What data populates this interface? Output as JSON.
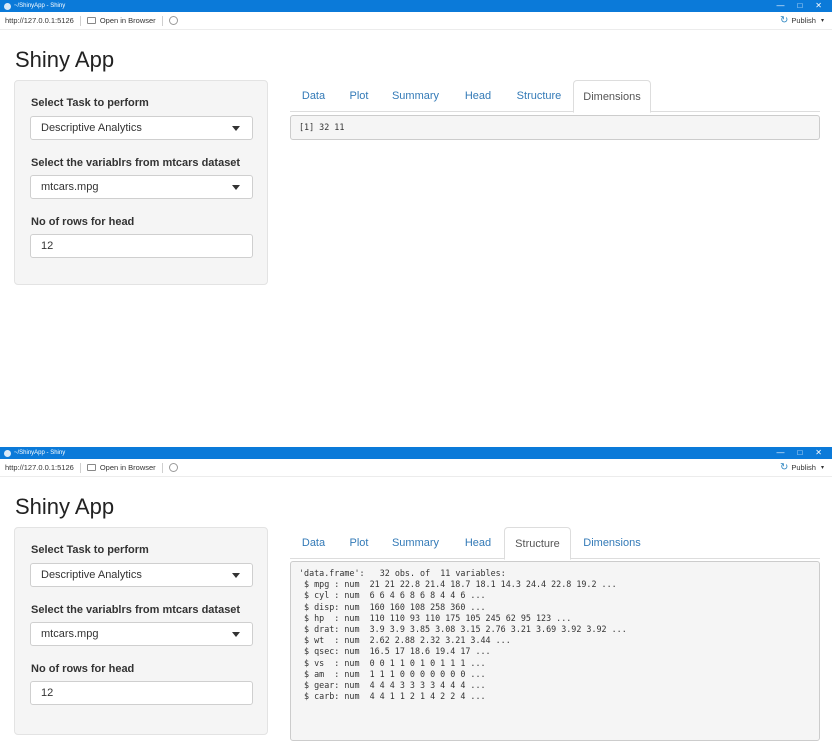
{
  "window": {
    "title": "~/ShinyApp - Shiny",
    "minimize": "—",
    "restore": "□",
    "close": "✕"
  },
  "toolbar": {
    "url": "http://127.0.0.1:5126",
    "open_in_browser": "Open in Browser",
    "publish": "Publish",
    "publish_caret": "▾"
  },
  "app": {
    "title": "Shiny App"
  },
  "sidebar": {
    "task_label": "Select Task to perform",
    "task_value": "Descriptive Analytics",
    "variable_label": "Select the variablrs from mtcars dataset",
    "variable_value": "mtcars.mpg",
    "rows_label": "No of rows for head",
    "rows_value": "12"
  },
  "tabs": [
    "Data",
    "Plot",
    "Summary",
    "Head",
    "Structure",
    "Dimensions"
  ],
  "screens": [
    {
      "active_tab": "Dimensions",
      "output": "[1] 32 11"
    },
    {
      "active_tab": "Structure",
      "output": "'data.frame':\t32 obs. of  11 variables:\n $ mpg : num  21 21 22.8 21.4 18.7 18.1 14.3 24.4 22.8 19.2 ...\n $ cyl : num  6 6 4 6 8 6 8 4 4 6 ...\n $ disp: num  160 160 108 258 360 ...\n $ hp  : num  110 110 93 110 175 105 245 62 95 123 ...\n $ drat: num  3.9 3.9 3.85 3.08 3.15 2.76 3.21 3.69 3.92 3.92 ...\n $ wt  : num  2.62 2.88 2.32 3.21 3.44 ...\n $ qsec: num  16.5 17 18.6 19.4 17 ...\n $ vs  : num  0 0 1 1 0 1 0 1 1 1 ...\n $ am  : num  1 1 1 0 0 0 0 0 0 0 ...\n $ gear: num  4 4 4 3 3 3 3 4 4 4 ...\n $ carb: num  4 4 1 1 2 1 4 2 2 4 ..."
    }
  ]
}
